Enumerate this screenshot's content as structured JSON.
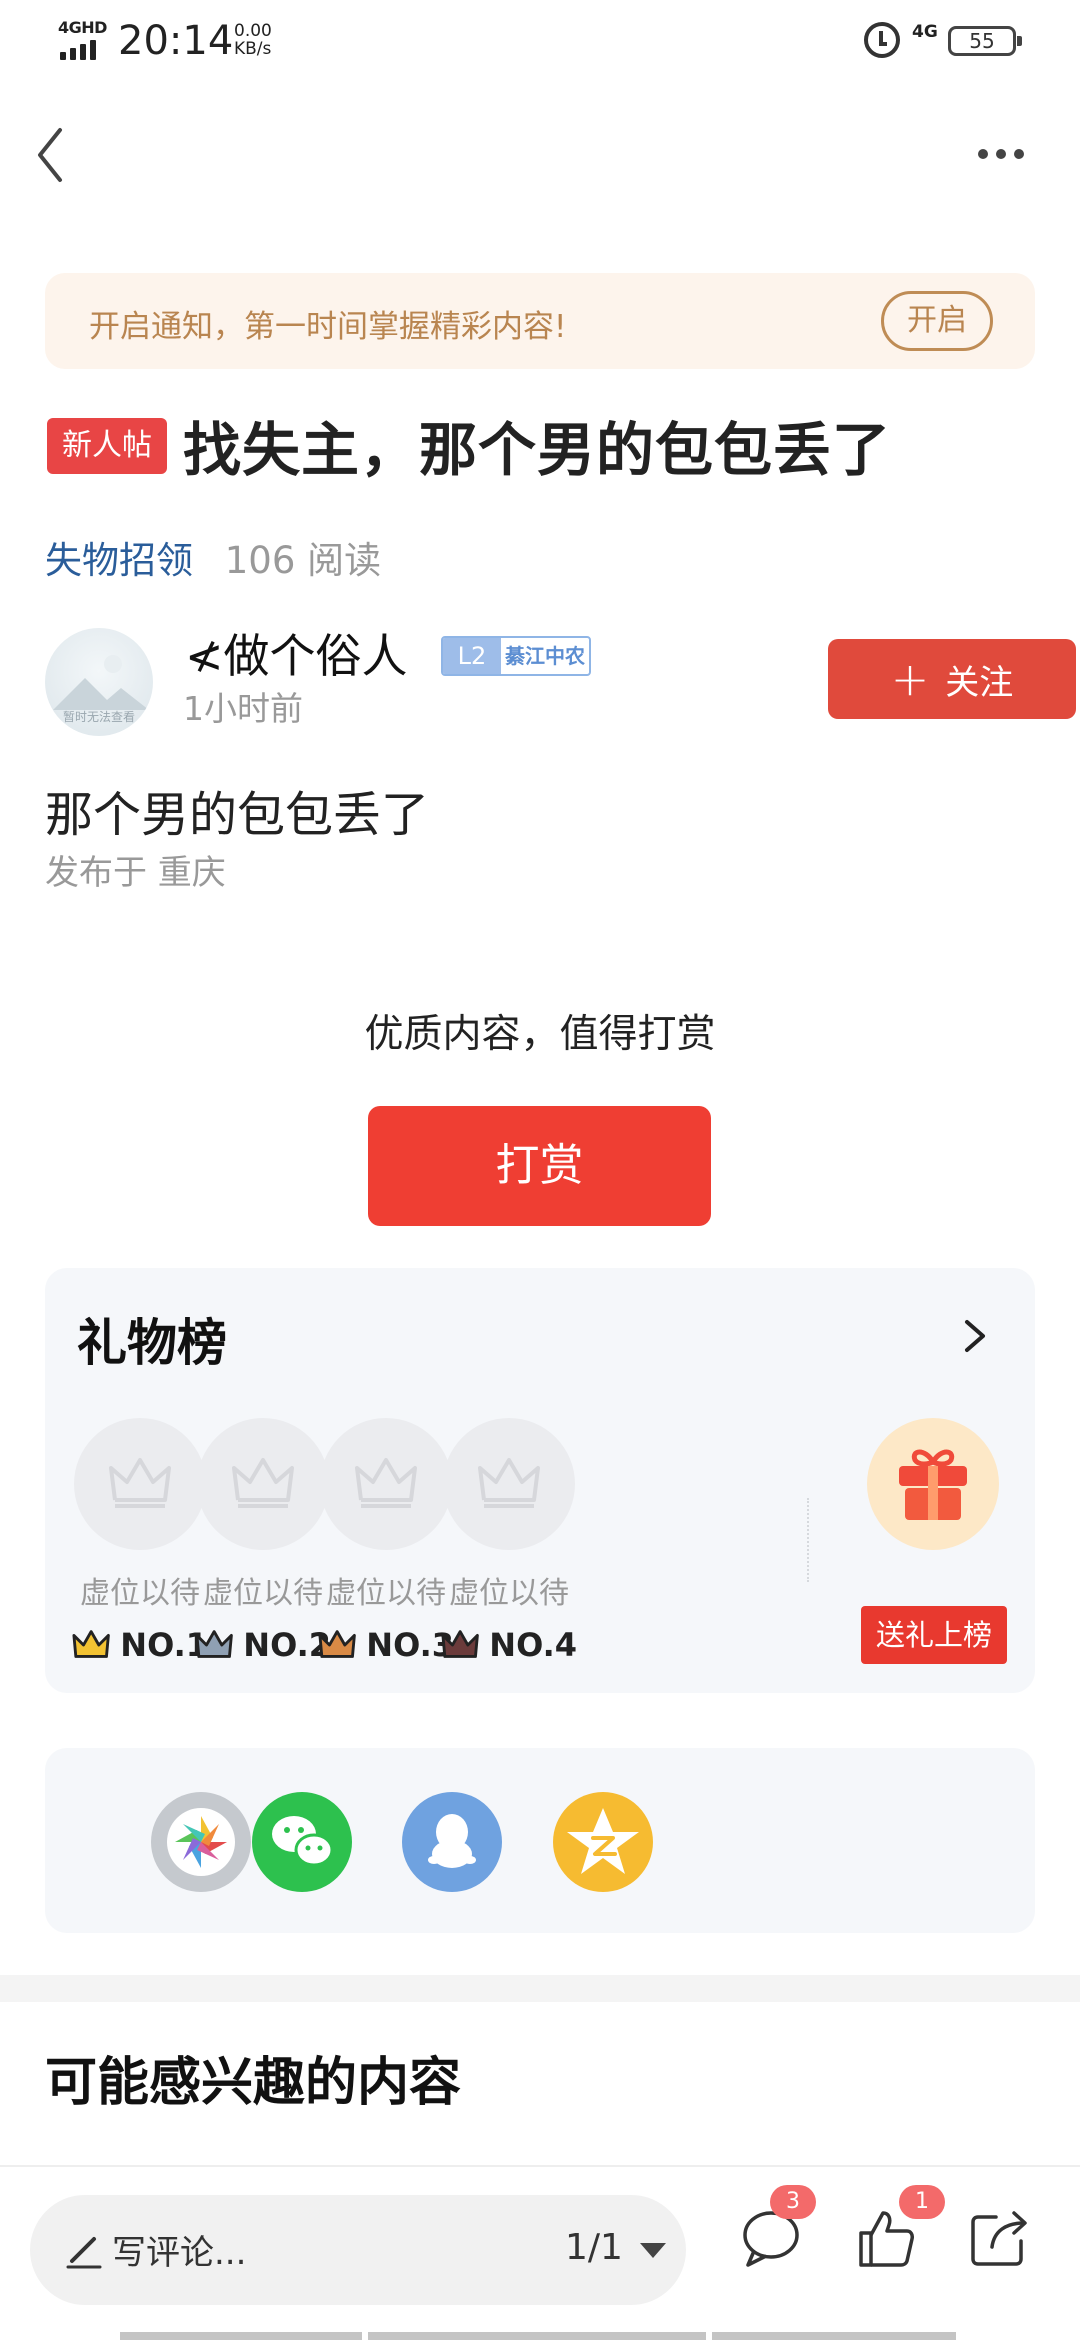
{
  "status_bar": {
    "network": "4GHD",
    "time": "20:14",
    "speed_value": "0.00",
    "speed_unit": "KB/s",
    "mobile": "4G",
    "battery": "55"
  },
  "notify": {
    "text": "开启通知，第一时间掌握精彩内容!",
    "button": "开启"
  },
  "post": {
    "badge": "新人帖",
    "title": "找失主，那个男的包包丢了",
    "category": "失物招领",
    "read_count": "106 阅读",
    "body": "那个男的包包丢了",
    "location": "发布于 重庆"
  },
  "author": {
    "name": "≮做个俗人",
    "level": "L2",
    "level_tag": "綦江中农",
    "time": "1小时前",
    "avatar_caption": "暂时无法查看",
    "follow": "关注"
  },
  "tip": {
    "title": "优质内容，值得打赏",
    "button": "打赏"
  },
  "gift_board": {
    "title": "礼物榜",
    "slots": [
      {
        "label": "虚位以待",
        "rank": "NO.1",
        "crown_color": "#f2c232"
      },
      {
        "label": "虚位以待",
        "rank": "NO.2",
        "crown_color": "#8fa0b3"
      },
      {
        "label": "虚位以待",
        "rank": "NO.3",
        "crown_color": "#d98a45"
      },
      {
        "label": "虚位以待",
        "rank": "NO.4",
        "crown_color": "#6b3b3b"
      }
    ],
    "send_button": "送礼上榜"
  },
  "share": {
    "items": [
      {
        "name": "moments",
        "icon": "moments-icon",
        "color": "#c5c9ce"
      },
      {
        "name": "wechat",
        "icon": "wechat-icon",
        "color": "#2dc14e"
      },
      {
        "name": "qq",
        "icon": "qq-icon",
        "color": "#6fa2e0"
      },
      {
        "name": "qzone",
        "icon": "qzone-icon",
        "color": "#f6bb31"
      }
    ]
  },
  "interest": {
    "title": "可能感兴趣的内容"
  },
  "bottom_bar": {
    "comment_placeholder": "写评论...",
    "page": "1/1",
    "comment_count": "3",
    "like_count": "1"
  },
  "colors": {
    "accent_red": "#e84545",
    "notify_bg": "#fdf4ec",
    "notify_text": "#b98550",
    "category_blue": "#2a5d9a"
  }
}
